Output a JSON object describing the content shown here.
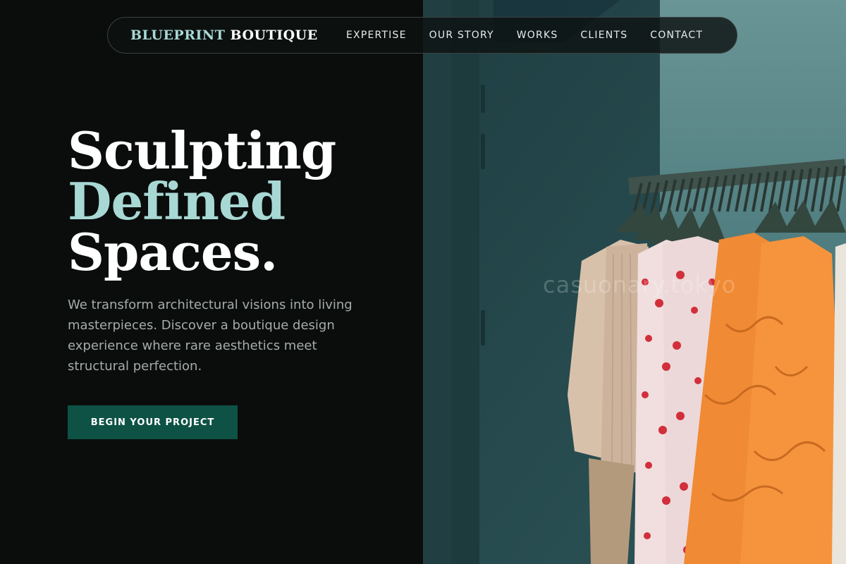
{
  "brand": {
    "part1": "BLUEPRINT",
    "part2": "BOUTIQUE"
  },
  "nav": {
    "items": [
      {
        "label": "EXPERTISE"
      },
      {
        "label": "OUR STORY"
      },
      {
        "label": "WORKS"
      },
      {
        "label": "CLIENTS"
      },
      {
        "label": "CONTACT"
      }
    ]
  },
  "hero": {
    "line1": "Sculpting",
    "line2": "Defined",
    "line3": "Spaces.",
    "description": "We transform architectural visions into living masterpieces. Discover a boutique design experience where rare aesthetics meet structural perfection.",
    "cta_label": "BEGIN YOUR PROJECT"
  },
  "image": {
    "watermark": "casuonary.tokyo"
  },
  "colors": {
    "background": "#0a0d0c",
    "accent": "#a8d8d4",
    "button": "#0d5245",
    "orange": "#f08a34",
    "wall": "#27494c"
  }
}
